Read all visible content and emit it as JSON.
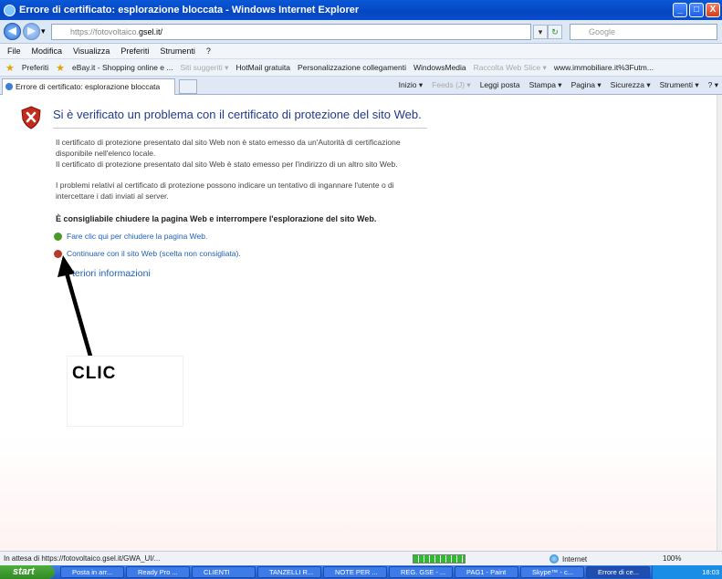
{
  "window": {
    "title": "Errore di certificato: esplorazione bloccata - Windows Internet Explorer",
    "min": "_",
    "max": "□",
    "close": "X"
  },
  "address": {
    "url_prefix": "https://fotovoltaico.",
    "url_host": "gsel.it/",
    "search_placeholder": "Google",
    "back": "◀",
    "forward": "▶",
    "dropdown": "▾",
    "refresh": "↻",
    "stop": "✕"
  },
  "menu": [
    "File",
    "Modifica",
    "Visualizza",
    "Preferiti",
    "Strumenti",
    "?"
  ],
  "favorites": {
    "label": "Preferiti",
    "items": [
      {
        "label": "eBay.it - Shopping online e ...",
        "dim": false
      },
      {
        "label": "Siti suggeriti ▾",
        "dim": true
      },
      {
        "label": "HotMail gratuita",
        "dim": false
      },
      {
        "label": "Personalizzazione collegamenti",
        "dim": false
      },
      {
        "label": "WindowsMedia",
        "dim": false
      },
      {
        "label": "Raccolta Web Slice ▾",
        "dim": true
      },
      {
        "label": "www.immobiliare.it%3Futm...",
        "dim": false
      }
    ]
  },
  "tab": {
    "label": "Errore di certificato: esplorazione bloccata"
  },
  "commandbar": [
    {
      "label": "Inizio ▾",
      "dim": false
    },
    {
      "label": "Feeds (J) ▾",
      "dim": true
    },
    {
      "label": "Leggi posta",
      "dim": false
    },
    {
      "label": "Stampa ▾",
      "dim": false
    },
    {
      "label": "Pagina ▾",
      "dim": false
    },
    {
      "label": "Sicurezza ▾",
      "dim": false
    },
    {
      "label": "Strumenti ▾",
      "dim": false
    },
    {
      "label": "? ▾",
      "dim": false
    }
  ],
  "error_page": {
    "title": "Si è verificato un problema con il certificato di protezione del sito Web.",
    "p1_line1": "Il certificato di protezione presentato dal sito Web non è stato emesso da un'Autorità di certificazione",
    "p1_line2": "disponibile nell'elenco locale.",
    "p1_line3": "Il certificato di protezione presentato dal sito Web è stato emesso per l'indirizzo di un altro sito Web.",
    "p2_line1": "I problemi relativi al certificato di protezione possono indicare un tentativo di ingannare l'utente o di",
    "p2_line2": "intercettare i dati inviati al server.",
    "recommendation": "È consigliabile chiudere la pagina Web e interrompere l'esplorazione del sito Web.",
    "close_link": "Fare clic qui per chiudere la pagina Web.",
    "continue_link": "Continuare con il sito Web (scelta non consigliata).",
    "more_info": "teriori informazioni"
  },
  "annotation": {
    "text": "CLIC"
  },
  "status": {
    "text": "In attesa di https://fotovoltaico.gsel.it/GWA_UI/...",
    "progress": 1.0,
    "zone": "Internet",
    "zoom": "100%"
  },
  "taskbar": {
    "start": "start",
    "items": [
      {
        "label": "Posta in arr...",
        "active": false
      },
      {
        "label": "Ready Pro ...",
        "active": false
      },
      {
        "label": "CLIENTI",
        "active": false
      },
      {
        "label": "TANZELLI R...",
        "active": false
      },
      {
        "label": "NOTE PER ...",
        "active": false
      },
      {
        "label": "REG. GSE - ...",
        "active": false
      },
      {
        "label": "PAG1 - Paint",
        "active": false
      },
      {
        "label": "Skype™ - c...",
        "active": false
      },
      {
        "label": "Errore di ce...",
        "active": true
      }
    ],
    "clock": "18:03"
  }
}
